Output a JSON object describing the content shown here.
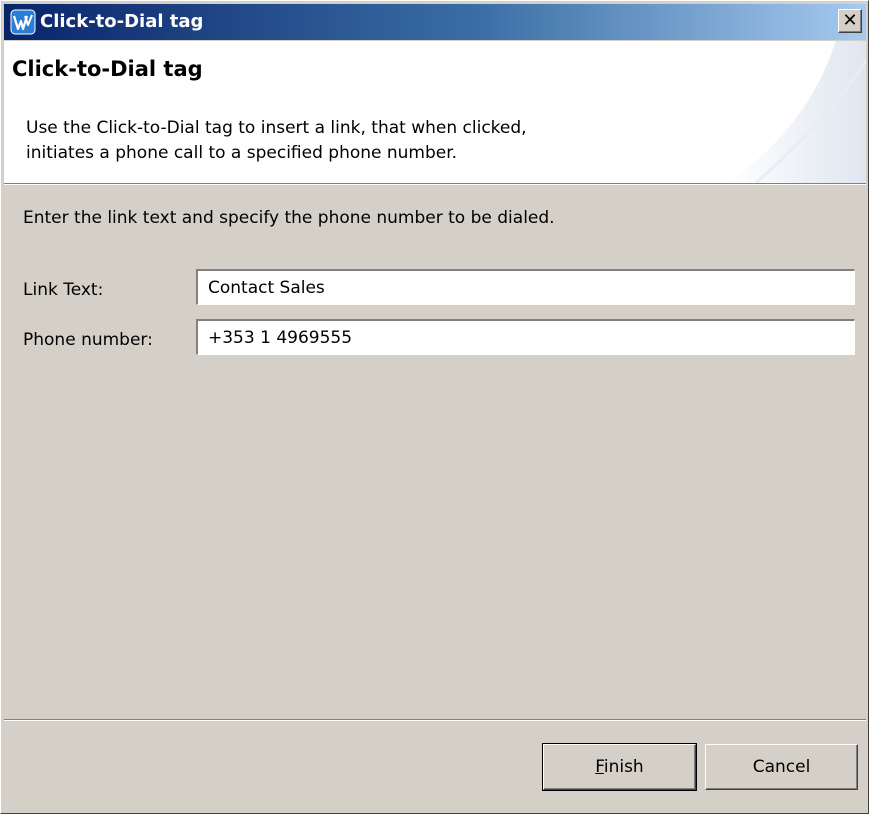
{
  "window": {
    "title": "Click-to-Dial tag",
    "close_label": "✕",
    "icon": "app-logo-icon"
  },
  "banner": {
    "title": "Click-to-Dial tag",
    "description_line1": "Use the Click-to-Dial tag to insert a link, that when clicked,",
    "description_line2": "initiates a phone call to a specified phone number."
  },
  "form": {
    "instruction": "Enter the link text and specify the phone number to be dialed.",
    "link_text": {
      "label": "Link Text:",
      "value": "Contact Sales"
    },
    "phone_number": {
      "label": "Phone number:",
      "value": "+353 1 4969555"
    }
  },
  "buttons": {
    "finish_mnemonic": "F",
    "finish_rest": "inish",
    "cancel": "Cancel"
  },
  "colors": {
    "title_gradient_start": "#0a246a",
    "title_gradient_end": "#a6caf0",
    "dialog_background": "#d4d0c8"
  }
}
